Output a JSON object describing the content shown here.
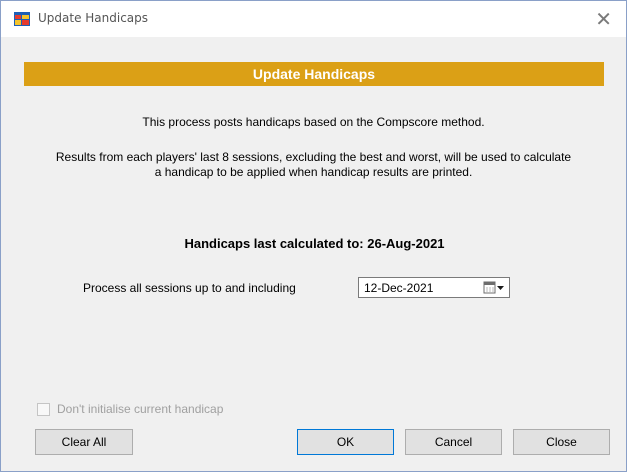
{
  "window": {
    "title": "Update Handicaps",
    "close_glyph": "✕",
    "icon": "app-window-icon"
  },
  "banner": {
    "title": "Update Handicaps",
    "color": "#dba016"
  },
  "description": {
    "line1": "This process posts handicaps based on the Compscore method.",
    "line2a": "Results from each players' last 8 sessions, excluding the best and worst, will be used to calculate",
    "line2b": "a handicap to be applied when handicap results are printed."
  },
  "last_calculated": "Handicaps last calculated to: 26-Aug-2021",
  "process": {
    "label": "Process all sessions up to and including",
    "date_value": "12-Dec-2021",
    "picker_icon": "calendar-dropdown-icon"
  },
  "options": {
    "initialise_label": "Don't initialise current handicap",
    "initialise_checked": false,
    "initialise_enabled": false
  },
  "buttons": {
    "clear_all": "Clear All",
    "ok": "OK",
    "cancel": "Cancel",
    "close": "Close"
  }
}
